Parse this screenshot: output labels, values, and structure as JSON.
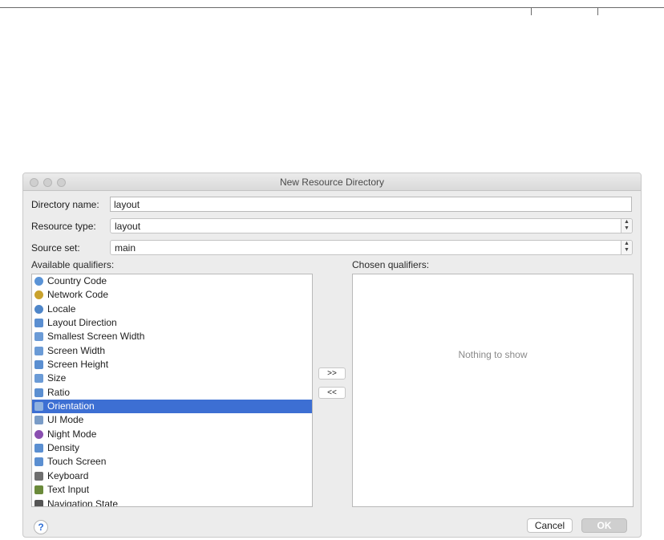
{
  "window": {
    "title": "New Resource Directory"
  },
  "form": {
    "directory_name_label": "Directory name:",
    "directory_name_value": "layout",
    "resource_type_label": "Resource type:",
    "resource_type_value": "layout",
    "source_set_label": "Source set:",
    "source_set_value": "main"
  },
  "available": {
    "label": "Available qualifiers:",
    "items": [
      {
        "label": "Country Code",
        "icon": "globe-flag-icon",
        "color": "#5a93d6"
      },
      {
        "label": "Network Code",
        "icon": "network-globe-icon",
        "color": "#c9a22d"
      },
      {
        "label": "Locale",
        "icon": "globe-icon",
        "color": "#4f86c9"
      },
      {
        "label": "Layout Direction",
        "icon": "layout-direction-icon",
        "color": "#5b8fd1"
      },
      {
        "label": "Smallest Screen Width",
        "icon": "smallest-width-icon",
        "color": "#6b9bd6"
      },
      {
        "label": "Screen Width",
        "icon": "screen-width-icon",
        "color": "#6b9bd6"
      },
      {
        "label": "Screen Height",
        "icon": "screen-height-icon",
        "color": "#5b8fd1"
      },
      {
        "label": "Size",
        "icon": "size-icon",
        "color": "#6b9bd6"
      },
      {
        "label": "Ratio",
        "icon": "ratio-icon",
        "color": "#5b8fd1"
      },
      {
        "label": "Orientation",
        "icon": "orientation-icon",
        "color": "#8fb1df"
      },
      {
        "label": "UI Mode",
        "icon": "ui-mode-icon",
        "color": "#7a9cc7"
      },
      {
        "label": "Night Mode",
        "icon": "night-mode-icon",
        "color": "#8a4fb0"
      },
      {
        "label": "Density",
        "icon": "density-icon",
        "color": "#5b8fd1"
      },
      {
        "label": "Touch Screen",
        "icon": "touch-screen-icon",
        "color": "#5b8fd1"
      },
      {
        "label": "Keyboard",
        "icon": "keyboard-icon",
        "color": "#6f6f6f"
      },
      {
        "label": "Text Input",
        "icon": "text-input-icon",
        "color": "#6a8a3a"
      },
      {
        "label": "Navigation State",
        "icon": "navigation-state-icon",
        "color": "#555555"
      }
    ],
    "selected": "Orientation"
  },
  "chosen": {
    "label": "Chosen qualifiers:",
    "empty_text": "Nothing to show"
  },
  "buttons": {
    "add": ">>",
    "remove": "<<",
    "help": "?",
    "cancel": "Cancel",
    "ok": "OK"
  },
  "colors": {
    "selection": "#3d6fd3",
    "help_accent": "#2f6fd6"
  }
}
